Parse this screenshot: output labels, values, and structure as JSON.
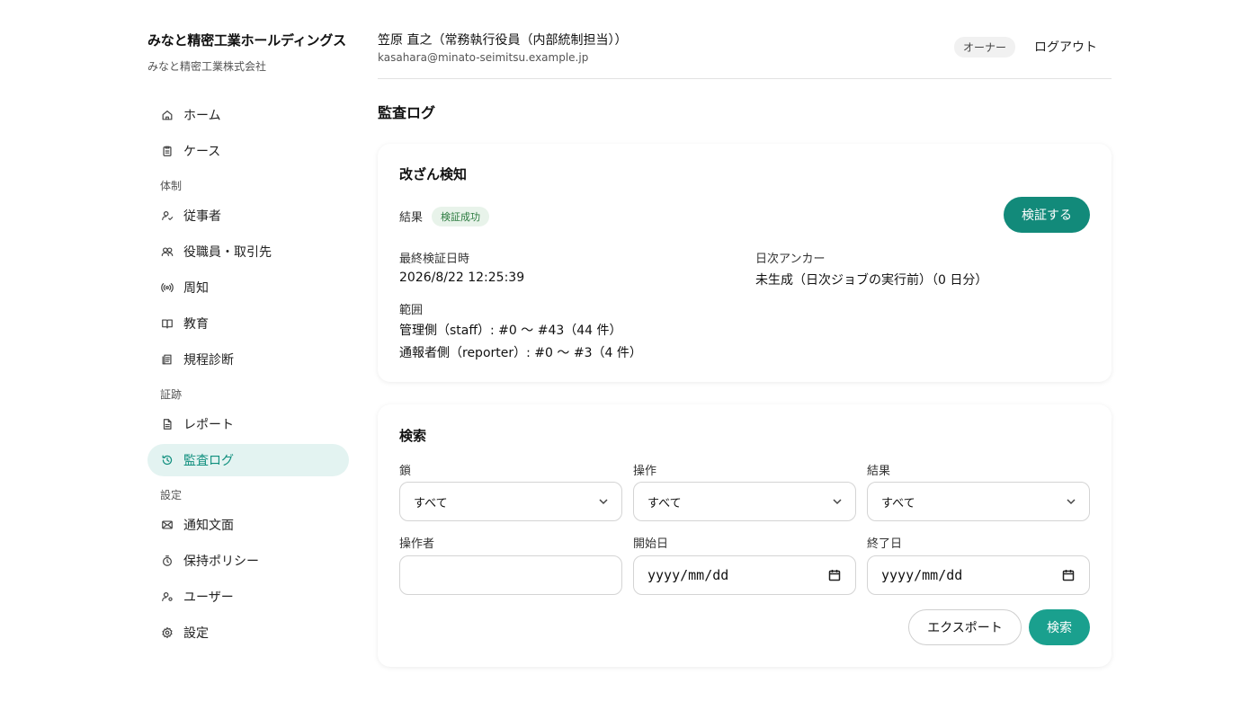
{
  "org": {
    "name": "みなと精密工業ホールディングス",
    "subsidiary": "みなと精密工業株式会社"
  },
  "sidebar": {
    "items_top": [
      {
        "label": "ホーム",
        "icon": "home-icon"
      },
      {
        "label": "ケース",
        "icon": "clipboard-icon"
      }
    ],
    "section_system": "体制",
    "items_system": [
      {
        "label": "従事者",
        "icon": "user-check-icon"
      },
      {
        "label": "役職員・取引先",
        "icon": "users-icon"
      },
      {
        "label": "周知",
        "icon": "broadcast-icon"
      },
      {
        "label": "教育",
        "icon": "book-icon"
      },
      {
        "label": "規程診断",
        "icon": "document-scan-icon"
      }
    ],
    "section_evidence": "証跡",
    "items_evidence": [
      {
        "label": "レポート",
        "icon": "report-icon"
      },
      {
        "label": "監査ログ",
        "icon": "history-icon",
        "active": true
      }
    ],
    "section_settings": "設定",
    "items_settings": [
      {
        "label": "通知文面",
        "icon": "mail-icon"
      },
      {
        "label": "保持ポリシー",
        "icon": "timer-icon"
      },
      {
        "label": "ユーザー",
        "icon": "user-settings-icon"
      },
      {
        "label": "設定",
        "icon": "gear-icon"
      }
    ]
  },
  "header": {
    "user_name": "笠原 直之（常務執行役員（内部統制担当））",
    "user_email": "kasahara@minato-seimitsu.example.jp",
    "role": "オーナー",
    "logout": "ログアウト"
  },
  "page": {
    "title": "監査ログ"
  },
  "tamper": {
    "title": "改ざん検知",
    "result_label": "結果",
    "result_value": "検証成功",
    "verify_button": "検証する",
    "last_verified_label": "最終検証日時",
    "last_verified_value": "2026/8/22 12:25:39",
    "daily_anchor_label": "日次アンカー",
    "daily_anchor_value": "未生成（日次ジョブの実行前）（0 日分）",
    "range_label": "範囲",
    "range_staff": "管理側（staff）: #0 〜 #43（44 件）",
    "range_reporter": "通報者側（reporter）: #0 〜 #3（4 件）"
  },
  "search": {
    "title": "検索",
    "chain_label": "鎖",
    "chain_value": "すべて",
    "action_label": "操作",
    "action_value": "すべて",
    "result_label": "結果",
    "result_value": "すべて",
    "operator_label": "操作者",
    "operator_value": "",
    "start_label": "開始日",
    "start_placeholder": "yyyy/mm/dd",
    "end_label": "終了日",
    "end_placeholder": "yyyy/mm/dd",
    "export_button": "エクスポート",
    "search_button": "検索"
  },
  "colors": {
    "accent": "#128a7a",
    "active_bg": "#e3f3f1",
    "success_bg": "#e8f3ea",
    "success_text": "#2a7a3e"
  }
}
